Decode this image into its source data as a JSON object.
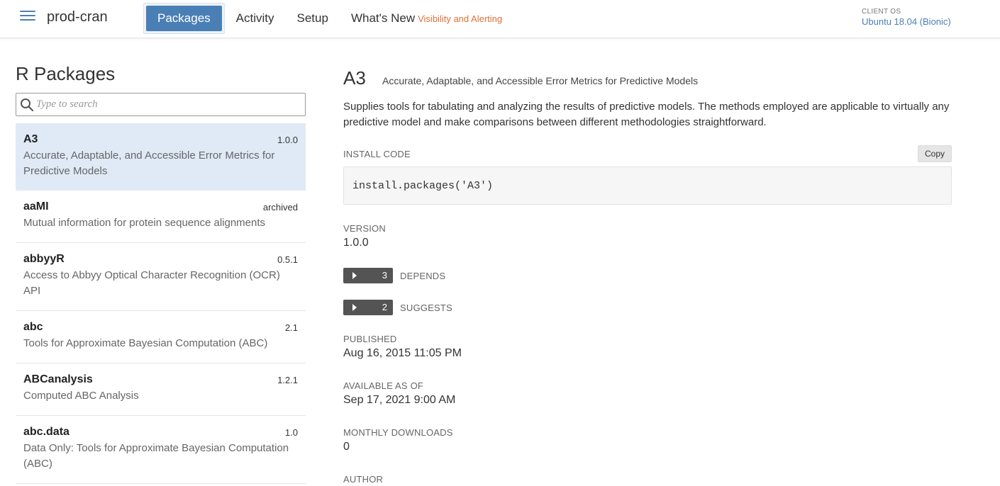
{
  "header": {
    "brand": "prod-cran",
    "nav": [
      {
        "label": "Packages"
      },
      {
        "label": "Activity"
      },
      {
        "label": "Setup"
      },
      {
        "label": "What's New"
      }
    ],
    "whats_new_tag": "Visibility and Alerting",
    "client_os_label": "CLIENT OS",
    "client_os_value": "Ubuntu 18.04 (Bionic)",
    "colors": {
      "accent": "#4a7fb5",
      "highlight": "#e0703a",
      "selected_row": "#dfeaf6"
    }
  },
  "sidebar": {
    "title": "R Packages",
    "search_placeholder": "Type to search",
    "packages": [
      {
        "name": "A3",
        "version": "1.0.0",
        "description": "Accurate, Adaptable, and Accessible Error Metrics for Predictive Models",
        "selected": true
      },
      {
        "name": "aaMI",
        "version": "archived",
        "description": "Mutual information for protein sequence alignments"
      },
      {
        "name": "abbyyR",
        "version": "0.5.1",
        "description": "Access to Abbyy Optical Character Recognition (OCR) API"
      },
      {
        "name": "abc",
        "version": "2.1",
        "description": "Tools for Approximate Bayesian Computation (ABC)"
      },
      {
        "name": "ABCanalysis",
        "version": "1.2.1",
        "description": "Computed ABC Analysis"
      },
      {
        "name": "abc.data",
        "version": "1.0",
        "description": "Data Only: Tools for Approximate Bayesian Computation (ABC)"
      }
    ]
  },
  "detail": {
    "name": "A3",
    "subtitle": "Accurate, Adaptable, and Accessible Error Metrics for Predictive Models",
    "description": "Supplies tools for tabulating and analyzing the results of predictive models. The methods employed are applicable to virtually any predictive model and make comparisons between different methodologies straightforward.",
    "install_label": "INSTALL CODE",
    "copy_label": "Copy",
    "install_code": "install.packages('A3')",
    "version_label": "VERSION",
    "version": "1.0.0",
    "depends_count": "3",
    "depends_label": "DEPENDS",
    "suggests_count": "2",
    "suggests_label": "SUGGESTS",
    "published_label": "PUBLISHED",
    "published": "Aug 16, 2015 11:05 PM",
    "available_label": "AVAILABLE AS OF",
    "available": "Sep 17, 2021 9:00 AM",
    "downloads_label": "MONTHLY DOWNLOADS",
    "downloads": "0",
    "author_label": "AUTHOR"
  }
}
